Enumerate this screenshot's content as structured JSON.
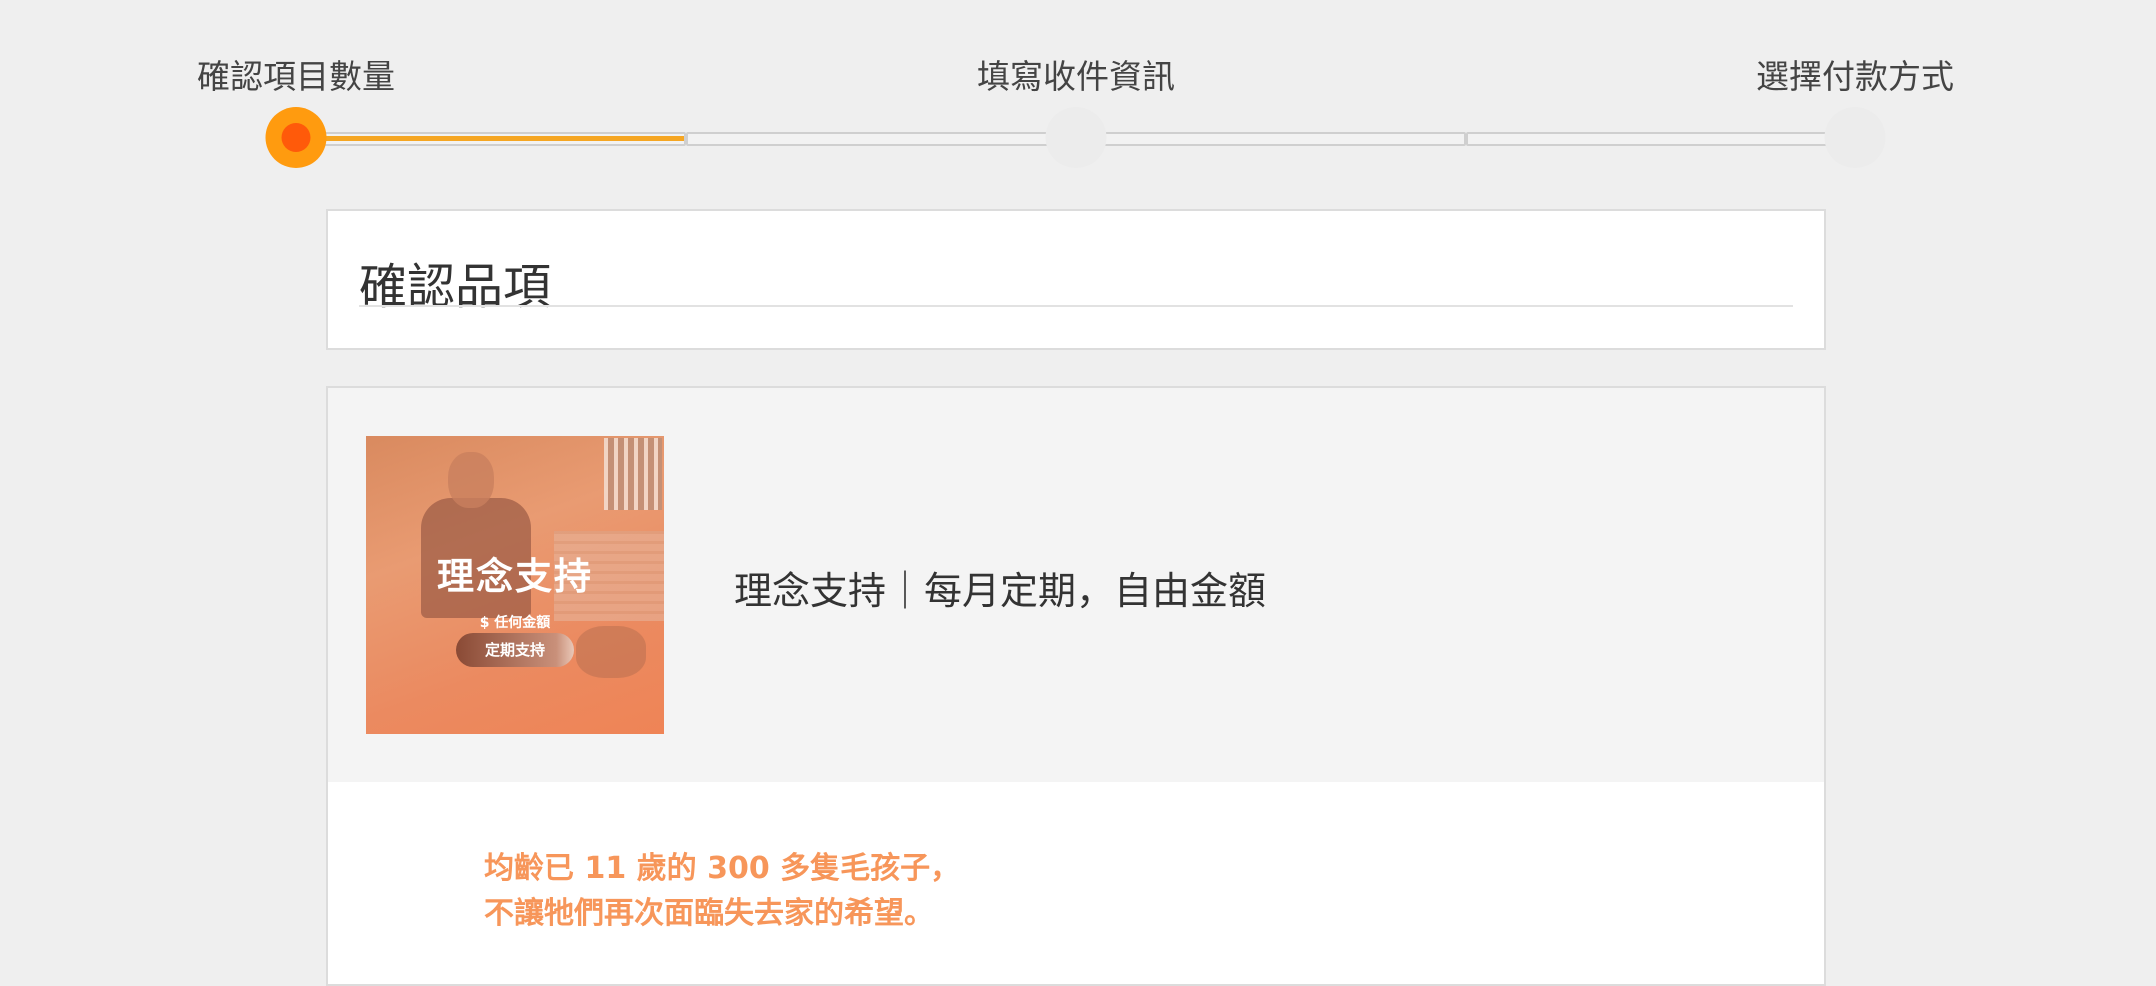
{
  "stepper": {
    "steps": [
      {
        "label": "確認項目數量",
        "active": true
      },
      {
        "label": "填寫收件資訊",
        "active": false
      },
      {
        "label": "選擇付款方式",
        "active": false
      }
    ],
    "progress": 0.5,
    "colors": {
      "accent": "#ff9b0f",
      "accent_inner": "#ff5a0a",
      "fill": "#f5a623"
    }
  },
  "section": {
    "title": "確認品項"
  },
  "product": {
    "image": {
      "title": "理念支持",
      "price_text": "$ 任何金額",
      "pill_text": "定期支持"
    },
    "name": "理念支持｜每月定期，自由金額"
  },
  "quote": {
    "lines": [
      "均齡已 11 歲的 300 多隻毛孩子，",
      "不讓牠們再次面臨失去家的希望。"
    ],
    "color": "#f7965a"
  }
}
